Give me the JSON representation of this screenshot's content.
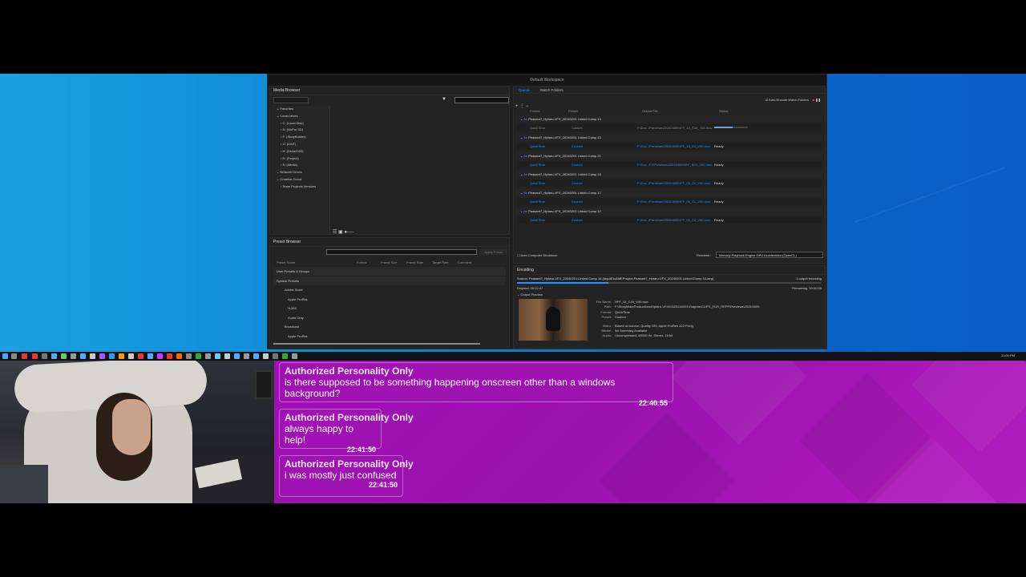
{
  "workspace": {
    "title": "Default Workspace"
  },
  "media_browser": {
    "title": "Media Browser",
    "tree": [
      "Favorites",
      "Local Drives",
      "C: (Local Disk)",
      "D: (NoPro SD)",
      "F: (StoryBuilder)",
      "G: (ASIT)",
      "H: (Sena2023)",
      "R: (Project)",
      "S: (Media)",
      "Network Drives",
      "Creative Cloud",
      "Team Projects Versions"
    ]
  },
  "preset_browser": {
    "title": "Preset Browser",
    "apply_label": "Apply Preset",
    "columns": [
      "Preset Name",
      "Format",
      "Frame Size",
      "Frame Rate",
      "Target Rate",
      "Comment"
    ],
    "items": [
      "User Presets & Groups",
      "System Presets",
      "Adobe Stock",
      "Apple ProRes",
      "H.264",
      "Audio Only",
      "Broadcast",
      "Apple ProRes"
    ]
  },
  "queue": {
    "tabs": [
      "Queue",
      "Watch Folders"
    ],
    "auto_encode": "Auto-Encode Watch Folders",
    "columns": [
      "Format",
      "Preset",
      "Output File",
      "Status"
    ],
    "items": [
      {
        "name": "Peasant7_Hptaru-VFX_20240201 Linked Comp 14",
        "format": "QuickTime",
        "preset": "Custom",
        "output": "F:\\Doc..\\Previews\\20240409\\HFF_14_C16_V00.mov",
        "status": ""
      },
      {
        "name": "Peasant7_Hptaru-VFX_20240201 Linked Comp 13",
        "format": "QuickTime",
        "preset": "Custom",
        "output": "F:\\Doc..\\Previews\\20240409\\HFF_13_C9_V00.mov",
        "status": "Ready"
      },
      {
        "name": "Peasant7_Hptaru-VFX_20240201 Linked Comp 21",
        "format": "QuickTime",
        "preset": "Custom",
        "output": "F:\\Doc..\\FX\\Previews\\20240409\\HFF_SK1_V00.mov",
        "status": "Ready"
      },
      {
        "name": "Peasant7_Hptaru-VFX_20240201 Linked Comp 18",
        "format": "QuickTime",
        "preset": "Custom",
        "output": "F:\\Doc..\\Previews\\20240409\\HFF_03_C1_V00.mov",
        "status": "Ready"
      },
      {
        "name": "Peasant7_Hptaru-VFX_20240201 Linked Comp 17",
        "format": "QuickTime",
        "preset": "Custom",
        "output": "F:\\Doc..\\Previews\\20240409\\HFF_04_C1_V00.mov",
        "status": "Ready"
      },
      {
        "name": "Peasant7_Hptaru-VFX_20240201 Linked Comp 12",
        "format": "QuickTime",
        "preset": "Custom",
        "output": "F:\\Doc..\\Previews\\20240409\\HFF_03_C3_V00.mov",
        "status": "Ready"
      }
    ],
    "progress": 0.55,
    "auto_shutdown": "Auto Computer Shutdown",
    "renderer_label": "Renderer:",
    "renderer_value": "Mercury Playback Engine GPU Acceleration (OpenCL)"
  },
  "encoding": {
    "title": "Encoding",
    "source": "Source: Peasant7_Hptaru-VFX_20240201 Linked Comp 14 (tmpAEtoAMEProject-Peasant7_Hptaru-VFX_20240201 Linked Comp 14.aep)",
    "outputs": "1 output encoding",
    "elapsed": "Elapsed: 00:02:47",
    "remaining": "Remaining: 00:00:39",
    "progress": 0.3,
    "preview_label": "Output Preview",
    "details": [
      {
        "k": "File Name:",
        "v": "HFF_14_C16_V00.mov"
      },
      {
        "k": "Path:",
        "v": "F:\\StoryMakeProductions\\Hptaru-VFX\\03\\20240201\\Outputs\\CLIPS_FOR_REPP\\Previews\\20240409\\"
      },
      {
        "k": "Format:",
        "v": "QuickTime"
      },
      {
        "k": "Preset:",
        "v": "Custom"
      },
      {
        "k": "Video:",
        "v": "Based on source, Quality 100, Apple ProRes 422 Proxy"
      },
      {
        "k": "Bitrate:",
        "v": "No Summary Available"
      },
      {
        "k": "Audio:",
        "v": "Uncompressed, 48000 Hz, Stereo, 16 bit"
      }
    ]
  },
  "chat": [
    {
      "name": "Authorized Personality Only",
      "text": "is there supposed to be something happening onscreen other than a windows background?",
      "time": "22:40:55"
    },
    {
      "name": "Authorized Personality Only",
      "text": "always happy to help!",
      "time": "22:41:50"
    },
    {
      "name": "Authorized Personality Only",
      "text": "i was mostly just confused",
      "time": "22:41:50"
    }
  ],
  "clock": "11:00 PM"
}
